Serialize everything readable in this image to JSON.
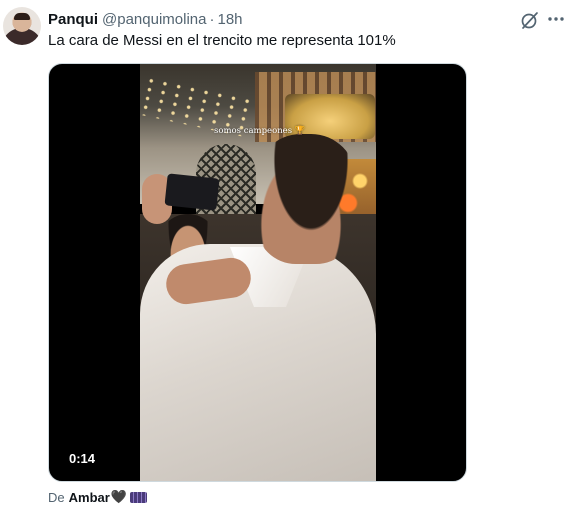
{
  "tweet": {
    "author_name": "Panqui",
    "handle": "@panquimolina",
    "separator": "·",
    "time": "18h",
    "text": "La cara de Messi en el trencito me representa 101%",
    "icons": [
      "grok-icon",
      "more-icon"
    ]
  },
  "media": {
    "caption": "somos campeones 🏆",
    "duration": "0:14"
  },
  "attribution": {
    "prefix": "De",
    "name": "Ambar",
    "emoji": "🖤",
    "badge_icon": "flag-badge-icon"
  },
  "colors": {
    "text_primary": "#0f1419",
    "text_secondary": "#536471",
    "media_background": "#000000"
  }
}
